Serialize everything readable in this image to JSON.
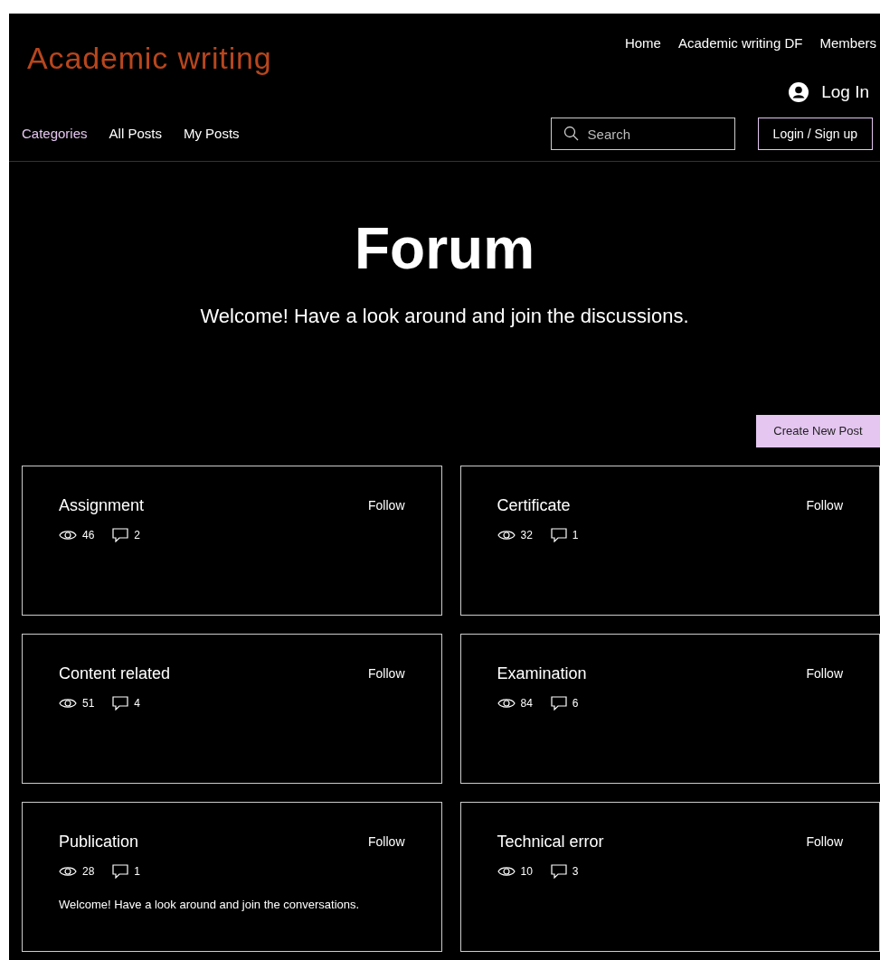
{
  "site": {
    "logo": "Academic writing",
    "top_nav": [
      "Home",
      "Academic writing DF",
      "Members"
    ],
    "login": "Log In"
  },
  "forum_nav": {
    "items": [
      {
        "label": "Categories",
        "selected": true
      },
      {
        "label": "All Posts",
        "selected": false
      },
      {
        "label": "My Posts",
        "selected": false
      }
    ],
    "search": {
      "placeholder": "Search"
    },
    "login_button": "Login / Sign up"
  },
  "hero": {
    "title": "Forum",
    "subtitle": "Welcome! Have a look around and join the discussions."
  },
  "create_button": "Create New Post",
  "categories": [
    {
      "title": "Assignment",
      "follow": "Follow",
      "views": "46",
      "comments": "2"
    },
    {
      "title": "Certificate",
      "follow": "Follow",
      "views": "32",
      "comments": "1"
    },
    {
      "title": "Content related",
      "follow": "Follow",
      "views": "51",
      "comments": "4"
    },
    {
      "title": "Examination",
      "follow": "Follow",
      "views": "84",
      "comments": "6"
    },
    {
      "title": "Publication",
      "follow": "Follow",
      "views": "28",
      "comments": "1",
      "description": "Welcome! Have a look around and join the conversations."
    },
    {
      "title": "Technical error",
      "follow": "Follow",
      "views": "10",
      "comments": "3"
    }
  ]
}
